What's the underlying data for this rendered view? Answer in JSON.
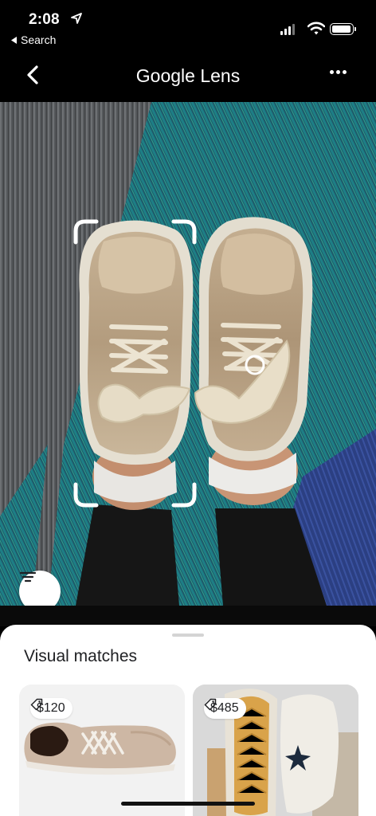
{
  "status_bar": {
    "time": "2:08",
    "back_app": "Search",
    "icons": [
      "location-arrow-icon",
      "signal-icon",
      "wifi-icon",
      "battery-icon"
    ]
  },
  "header": {
    "title": "Google Lens",
    "back_icon": "chevron-left-icon",
    "more_icon": "more-horizontal-icon"
  },
  "viewer": {
    "subject": "photo of beige sneakers on carpet",
    "filter_icon": "filter-icon"
  },
  "results": {
    "heading": "Visual matches",
    "items": [
      {
        "price": "$120",
        "icon": "price-tag-icon"
      },
      {
        "price": "$485",
        "icon": "price-tag-icon"
      }
    ]
  },
  "colors": {
    "background": "#000000",
    "sheet": "#ffffff",
    "text_dark": "#202124"
  }
}
